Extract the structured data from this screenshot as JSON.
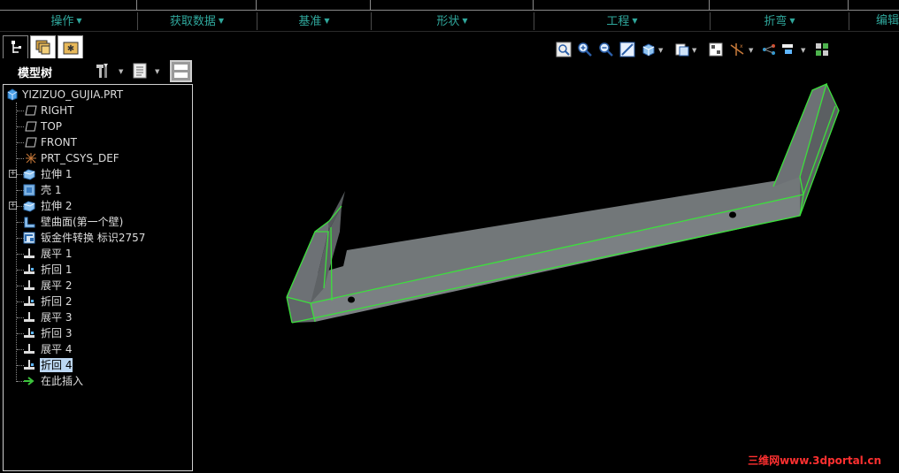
{
  "ribbon": {
    "menus": [
      {
        "label": "操作"
      },
      {
        "label": "获取数据"
      },
      {
        "label": "基准"
      },
      {
        "label": "形状"
      },
      {
        "label": "工程"
      },
      {
        "label": "折弯"
      },
      {
        "label": "编辑"
      }
    ]
  },
  "model_tree": {
    "title": "模型树",
    "items": [
      {
        "label": "YIZIZUO_GUJIA.PRT",
        "icon": "part-icon"
      },
      {
        "label": "RIGHT",
        "icon": "datum-plane-icon"
      },
      {
        "label": "TOP",
        "icon": "datum-plane-icon"
      },
      {
        "label": "FRONT",
        "icon": "datum-plane-icon"
      },
      {
        "label": "PRT_CSYS_DEF",
        "icon": "coordinate-system-icon"
      },
      {
        "label": "拉伸 1",
        "icon": "extrude-icon"
      },
      {
        "label": "壳 1",
        "icon": "shell-icon"
      },
      {
        "label": "拉伸 2",
        "icon": "extrude-icon"
      },
      {
        "label": "壁曲面(第一个壁)",
        "icon": "wall-surface-icon"
      },
      {
        "label": "钣金件转换 标识2757",
        "icon": "sheetmetal-convert-icon"
      },
      {
        "label": "展平 1",
        "icon": "unbend-icon"
      },
      {
        "label": "折回 1",
        "icon": "bend-back-icon"
      },
      {
        "label": "展平 2",
        "icon": "unbend-icon"
      },
      {
        "label": "折回 2",
        "icon": "bend-back-icon"
      },
      {
        "label": "展平 3",
        "icon": "unbend-icon"
      },
      {
        "label": "折回 3",
        "icon": "bend-back-icon"
      },
      {
        "label": "展平 4",
        "icon": "unbend-icon"
      },
      {
        "label": "折回 4",
        "icon": "bend-back-icon"
      },
      {
        "label": "在此插入",
        "icon": "insert-here-arrow-icon"
      }
    ]
  },
  "watermark": "三维网www.3dportal.cn",
  "colors": {
    "menu_text": "#2fa79c",
    "model_edge": "#3ce03c",
    "model_face": "#6e7377",
    "selected_row": "#bcd7f2",
    "watermark": "#ff3030"
  }
}
